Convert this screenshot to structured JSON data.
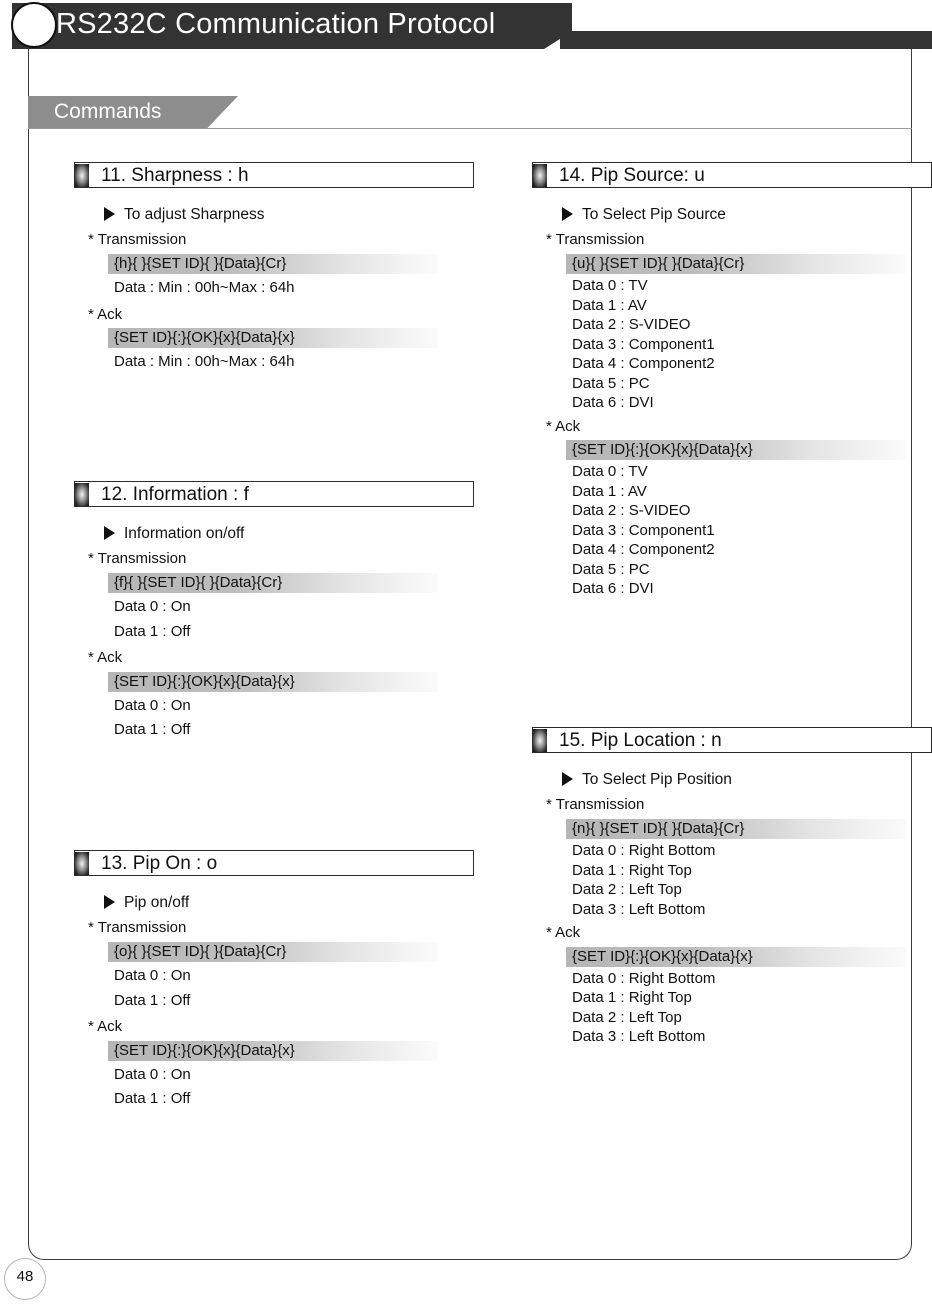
{
  "header": {
    "title": "RS232C Communication Protocol",
    "circle_icon": "circle-outline-icon"
  },
  "section": {
    "tab_label": "Commands"
  },
  "footer": {
    "page_number": "48"
  },
  "labels": {
    "transmission": "* Transmission",
    "ack": "* Ack"
  },
  "columns": {
    "left": [
      {
        "title": "11. Sharpness : h",
        "purpose": "To adjust Sharpness",
        "transmission_code": "{h}{ }{SET ID}{ }{Data}{Cr}",
        "transmission_data": [
          "Data : Min : 00h~Max : 64h"
        ],
        "ack_code": "{SET ID}{:}{OK}{x}{Data}{x}",
        "ack_data": [
          "Data : Min : 00h~Max : 64h"
        ]
      },
      {
        "title": "12. Information : f",
        "purpose": "Information on/off",
        "transmission_code": "{f}{ }{SET ID}{ }{Data}{Cr}",
        "transmission_data": [
          "Data 0 : On",
          "Data 1 : Off"
        ],
        "ack_code": "{SET ID}{:}{OK}{x}{Data}{x}",
        "ack_data": [
          "Data 0 : On",
          "Data 1 : Off"
        ]
      },
      {
        "title": "13. Pip On : o",
        "purpose": "Pip  on/off",
        "transmission_code": "{o}{ }{SET ID}{ }{Data}{Cr}",
        "transmission_data": [
          "Data 0 : On",
          "Data 1 : Off"
        ],
        "ack_code": "{SET ID}{:}{OK}{x}{Data}{x}",
        "ack_data": [
          "Data 0 : On",
          "Data 1 : Off"
        ]
      }
    ],
    "right": [
      {
        "title": "14. Pip Source: u",
        "purpose": "To Select Pip Source",
        "transmission_code": "{u}{ }{SET ID}{ }{Data}{Cr}",
        "transmission_data": [
          "Data 0 : TV",
          "Data 1 : AV",
          "Data 2 : S-VIDEO",
          "Data 3 : Component1",
          "Data 4 : Component2",
          "Data 5 : PC",
          "Data 6 : DVI"
        ],
        "ack_code": "{SET ID}{:}{OK}{x}{Data}{x}",
        "ack_data": [
          "Data 0 : TV",
          "Data 1 : AV",
          "Data 2 : S-VIDEO",
          "Data 3 : Component1",
          "Data 4 : Component2",
          "Data 5 : PC",
          "Data 6 : DVI"
        ]
      },
      {
        "title": "15. Pip Location : n",
        "purpose": "To Select Pip Position",
        "transmission_code": "{n}{ }{SET ID}{ }{Data}{Cr}",
        "transmission_data": [
          "Data 0 : Right Bottom",
          "Data 1 : Right Top",
          "Data 2 : Left Top",
          "Data 3 : Left Bottom"
        ],
        "ack_code": "{SET ID}{:}{OK}{x}{Data}{x}",
        "ack_data": [
          "Data 0 : Right Bottom",
          "Data 1 : Right Top",
          "Data 2 : Left Top",
          "Data 3 : Left Bottom"
        ]
      }
    ]
  },
  "layout": {
    "left_block_tops": [
      0,
      319,
      688
    ],
    "right_block_tops": [
      0,
      565
    ],
    "right_tight_lines": true
  },
  "colors": {
    "header_bar": "#333333",
    "section_tab": "#8d8d8d",
    "code_bar_start": "#b6b6b6",
    "text": "#111111",
    "frame_border": "#3a3a3a"
  }
}
